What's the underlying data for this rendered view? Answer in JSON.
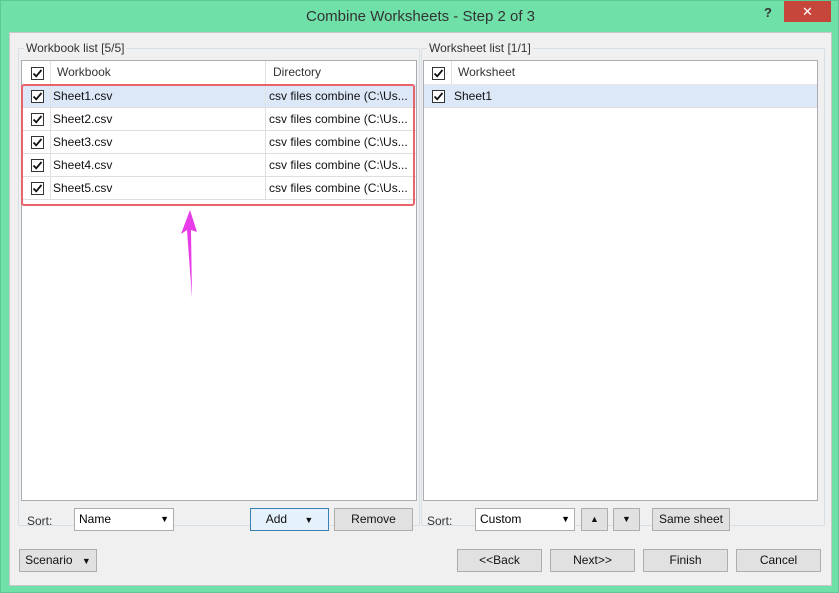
{
  "window": {
    "title": "Combine Worksheets - Step 2 of 3",
    "help": "?",
    "close": "✕"
  },
  "workbook_group": {
    "label": "Workbook list [5/5]",
    "columns": [
      "Workbook",
      "Directory"
    ],
    "rows": [
      {
        "workbook": "Sheet1.csv",
        "directory": "csv files combine (C:\\Us..."
      },
      {
        "workbook": "Sheet2.csv",
        "directory": "csv files combine (C:\\Us..."
      },
      {
        "workbook": "Sheet3.csv",
        "directory": "csv files combine (C:\\Us..."
      },
      {
        "workbook": "Sheet4.csv",
        "directory": "csv files combine (C:\\Us..."
      },
      {
        "workbook": "Sheet5.csv",
        "directory": "csv files combine (C:\\Us..."
      }
    ],
    "sort_label": "Sort:",
    "sort_value": "Name",
    "add_label": "Add",
    "remove_label": "Remove"
  },
  "worksheet_group": {
    "label": "Worksheet list [1/1]",
    "columns": [
      "Worksheet"
    ],
    "rows": [
      {
        "worksheet": "Sheet1"
      }
    ],
    "sort_label": "Sort:",
    "sort_value": "Custom",
    "same_sheet_label": "Same sheet"
  },
  "footer": {
    "scenario_label": "Scenario",
    "back_label": "<<Back",
    "next_label": "Next>>",
    "finish_label": "Finish",
    "cancel_label": "Cancel"
  },
  "colors": {
    "annotation_box": "#e8646a",
    "annotation_arrow": "#e83ce8",
    "selected_row": "#dce7f7",
    "title_bar": "#6fe0a8"
  },
  "icons": [
    "checkbox-checked-icon",
    "dropdown-arrow-icon",
    "up-arrow-icon",
    "down-arrow-icon",
    "help-icon",
    "close-icon"
  ]
}
